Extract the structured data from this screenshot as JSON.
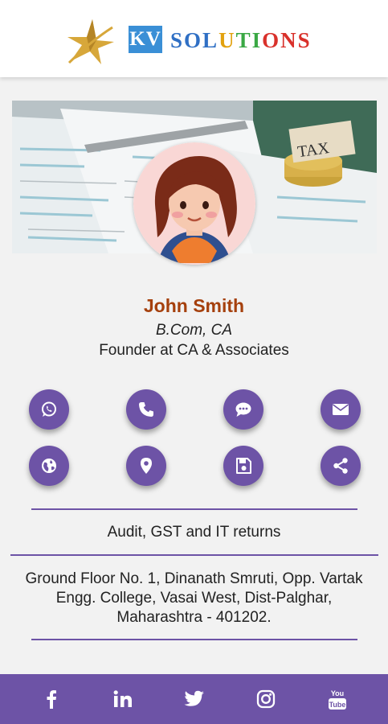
{
  "brand": {
    "kv": "KV",
    "solutions_letters": [
      {
        "ch": "S",
        "color": "#2f6fc4"
      },
      {
        "ch": "O",
        "color": "#2f6fc4"
      },
      {
        "ch": "L",
        "color": "#2f6fc4"
      },
      {
        "ch": "U",
        "color": "#e2a20f"
      },
      {
        "ch": "T",
        "color": "#3aa844"
      },
      {
        "ch": "I",
        "color": "#3aa844"
      },
      {
        "ch": "O",
        "color": "#d9312b"
      },
      {
        "ch": "N",
        "color": "#d9312b"
      },
      {
        "ch": "S",
        "color": "#d9312b"
      }
    ]
  },
  "banner": {
    "tax_text": "TAX"
  },
  "profile": {
    "name": "John Smith",
    "qualification": "B.Com, CA",
    "role": "Founder at CA & Associates"
  },
  "actions": [
    {
      "name": "whatsapp-button",
      "icon": "whatsapp-icon"
    },
    {
      "name": "call-button",
      "icon": "phone-icon"
    },
    {
      "name": "sms-button",
      "icon": "chat-icon"
    },
    {
      "name": "email-button",
      "icon": "envelope-icon"
    },
    {
      "name": "website-button",
      "icon": "globe-icon"
    },
    {
      "name": "location-button",
      "icon": "map-pin-icon"
    },
    {
      "name": "save-contact-button",
      "icon": "save-icon"
    },
    {
      "name": "share-button",
      "icon": "share-icon"
    }
  ],
  "services": "Audit, GST and IT returns",
  "address": "Ground Floor No. 1, Dinanath Smruti, Opp. Vartak Engg. College, Vasai West, Dist-Palghar, Maharashtra - 401202.",
  "footer": {
    "social": [
      {
        "name": "facebook-icon",
        "label": "f"
      },
      {
        "name": "linkedin-icon",
        "label": "in"
      },
      {
        "name": "twitter-icon",
        "label": ""
      },
      {
        "name": "instagram-icon",
        "label": ""
      },
      {
        "name": "youtube-icon",
        "label": "You Tube"
      }
    ]
  },
  "colors": {
    "accent": "#6d53a6",
    "name": "#a5400d",
    "kv_bg": "#3a8fd6"
  }
}
